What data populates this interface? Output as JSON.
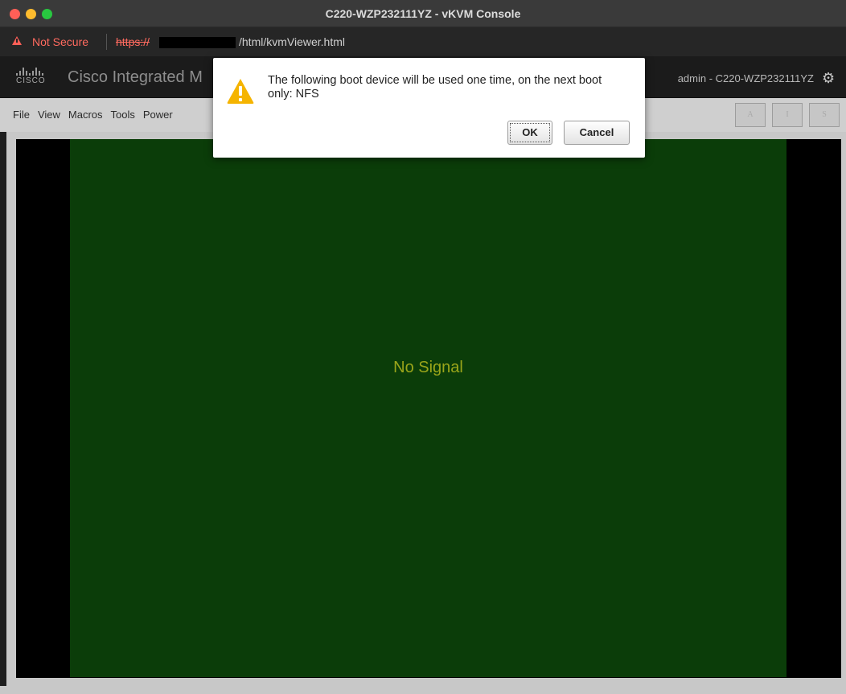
{
  "window": {
    "title": "C220-WZP232111YZ - vKVM Console"
  },
  "address_bar": {
    "security_label": "Not Secure",
    "protocol": "https://",
    "path": "/html/kvmViewer.html"
  },
  "header": {
    "logo_text": "CISCO",
    "app_title": "Cisco Integrated M",
    "user_label": "admin - C220-WZP232111YZ",
    "settings_icon": "gear-icon"
  },
  "menu": {
    "items": [
      {
        "label": "File"
      },
      {
        "label": "View"
      },
      {
        "label": "Macros"
      },
      {
        "label": "Tools"
      },
      {
        "label": "Power"
      }
    ]
  },
  "indicators": [
    {
      "label": "A"
    },
    {
      "label": "I"
    },
    {
      "label": "S"
    }
  ],
  "console": {
    "status_text": "No Signal",
    "screen_color": "#0b3d09",
    "text_color": "#9aa51a"
  },
  "dialog": {
    "icon": "warning-icon",
    "message": "The following boot device will be used one time, on the next boot only: NFS",
    "ok_label": "OK",
    "cancel_label": "Cancel"
  }
}
